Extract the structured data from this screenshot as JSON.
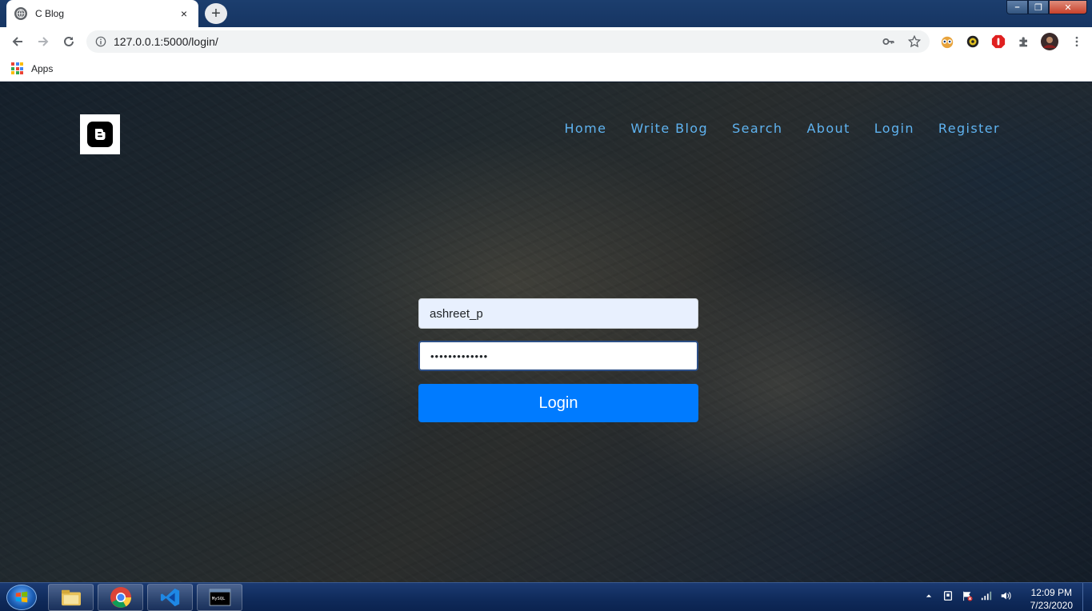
{
  "browser": {
    "tab_title": "C Blog",
    "tab_close": "×",
    "new_tab": "+",
    "url": "127.0.0.1:5000/login/",
    "bookmarks": {
      "apps_label": "Apps"
    },
    "window_buttons": {
      "minimize": "–",
      "maximize": "❐",
      "close": "✕"
    }
  },
  "site": {
    "logo_letter": "B",
    "nav": [
      "Home",
      "Write Blog",
      "Search",
      "About",
      "Login",
      "Register"
    ]
  },
  "login_form": {
    "username_value": "ashreet_p",
    "password_value": "•••••••••••••",
    "submit_label": "Login"
  },
  "taskbar": {
    "time": "12:09 PM",
    "date": "7/23/2020",
    "pinned": [
      "file-explorer-icon",
      "chrome-icon",
      "vscode-icon",
      "mysql-terminal-icon"
    ],
    "mysql_label": "MySQL"
  },
  "colors": {
    "nav_link": "#5fb3f0",
    "login_button": "#007bff",
    "username_field_bg": "#e8f0fe"
  }
}
